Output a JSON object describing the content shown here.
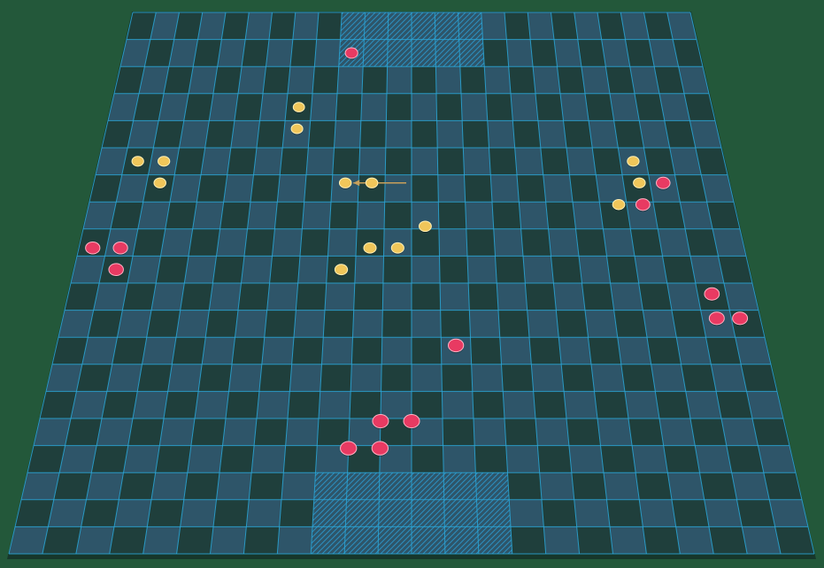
{
  "board": {
    "cols": 24,
    "rows": 20,
    "goal_zones": [
      {
        "name": "top-goal-zone",
        "col_start": 9,
        "col_end": 15,
        "row_start": 0,
        "row_end": 2
      },
      {
        "name": "bottom-goal-zone",
        "col_start": 9,
        "col_end": 15,
        "row_start": 17,
        "row_end": 20
      }
    ]
  },
  "colors": {
    "background": "#23583a",
    "board_edge": "#17372b",
    "dark_square": "#1f3f3c",
    "light_square": "#2e5569",
    "grid_line": "#2aa7d8",
    "hatch": "#2b8fbf",
    "yellow_piece": "#f0c65a",
    "yellow_piece_rim": "#fff1b8",
    "red_piece": "#e83a62",
    "red_piece_rim": "#ffb3c4",
    "arrow": "#c8a05a"
  },
  "pieces": [
    {
      "team": "red",
      "col": 9.5,
      "row": 1.5
    },
    {
      "team": "yellow",
      "col": 7.5,
      "row": 3.5
    },
    {
      "team": "yellow",
      "col": 7.5,
      "row": 4.3
    },
    {
      "team": "yellow",
      "col": 1.5,
      "row": 5.5
    },
    {
      "team": "yellow",
      "col": 2.5,
      "row": 5.5
    },
    {
      "team": "yellow",
      "col": 2.5,
      "row": 6.3
    },
    {
      "team": "yellow",
      "col": 9.5,
      "row": 6.3
    },
    {
      "team": "yellow",
      "col": 10.5,
      "row": 6.3
    },
    {
      "team": "yellow",
      "col": 12.5,
      "row": 7.9
    },
    {
      "team": "yellow",
      "col": 11.5,
      "row": 8.7
    },
    {
      "team": "yellow",
      "col": 10.5,
      "row": 8.7
    },
    {
      "team": "yellow",
      "col": 9.5,
      "row": 9.5
    },
    {
      "team": "yellow",
      "col": 20.5,
      "row": 5.5
    },
    {
      "team": "yellow",
      "col": 20.6,
      "row": 6.3
    },
    {
      "team": "yellow",
      "col": 19.7,
      "row": 7.1
    },
    {
      "team": "red",
      "col": 21.5,
      "row": 6.3
    },
    {
      "team": "red",
      "col": 20.6,
      "row": 7.1
    },
    {
      "team": "red",
      "col": 0.5,
      "row": 8.7
    },
    {
      "team": "red",
      "col": 1.5,
      "row": 8.7
    },
    {
      "team": "red",
      "col": 1.5,
      "row": 9.5
    },
    {
      "team": "red",
      "col": 22.5,
      "row": 10.4
    },
    {
      "team": "red",
      "col": 22.5,
      "row": 11.3
    },
    {
      "team": "red",
      "col": 23.3,
      "row": 11.3
    },
    {
      "team": "red",
      "col": 13.5,
      "row": 12.3
    },
    {
      "team": "red",
      "col": 11.0,
      "row": 15.1
    },
    {
      "team": "red",
      "col": 12.0,
      "row": 15.1
    },
    {
      "team": "red",
      "col": 10.0,
      "row": 16.1
    },
    {
      "team": "red",
      "col": 11.0,
      "row": 16.1
    }
  ],
  "move_arrow": {
    "from_col": 11.8,
    "from_row": 6.3,
    "to_col": 9.8,
    "to_row": 6.3
  }
}
